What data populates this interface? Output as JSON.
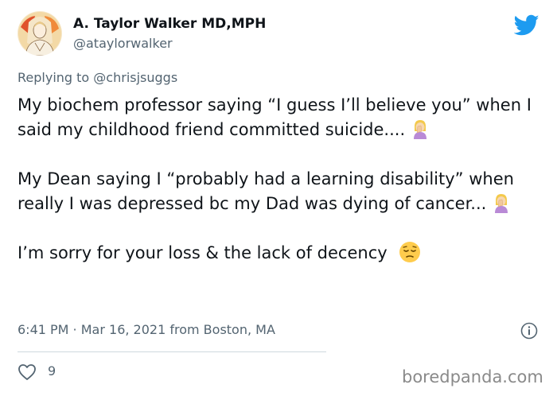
{
  "tweet": {
    "author": {
      "display_name": "A. Taylor Walker MD,MPH",
      "handle": "@ataylorwalker",
      "avatar_icon": "illustrated-portrait-avatar"
    },
    "reply": {
      "prefix": "Replying to ",
      "mention": "@chrisjsuggs"
    },
    "paragraphs": [
      {
        "text": "My biochem professor saying “I guess I’ll believe you” when I said my childhood friend committed suicide....",
        "trailing_emoji": "woman-facepalming-emoji"
      },
      {
        "text": "My Dean saying I “probably had a learning disability” when really I was depressed bc my Dad was dying of cancer...",
        "trailing_emoji": "woman-facepalming-emoji"
      },
      {
        "text": "I’m sorry for your loss & the lack of decency",
        "trailing_emoji": "pensive-face-emoji"
      }
    ],
    "meta": {
      "time": "6:41 PM",
      "separator": " · ",
      "date": "Mar 16, 2021",
      "location": " from Boston, MA"
    },
    "likes": "9",
    "brand_color": "#1d9bf0"
  },
  "watermark": "boredpanda.com"
}
